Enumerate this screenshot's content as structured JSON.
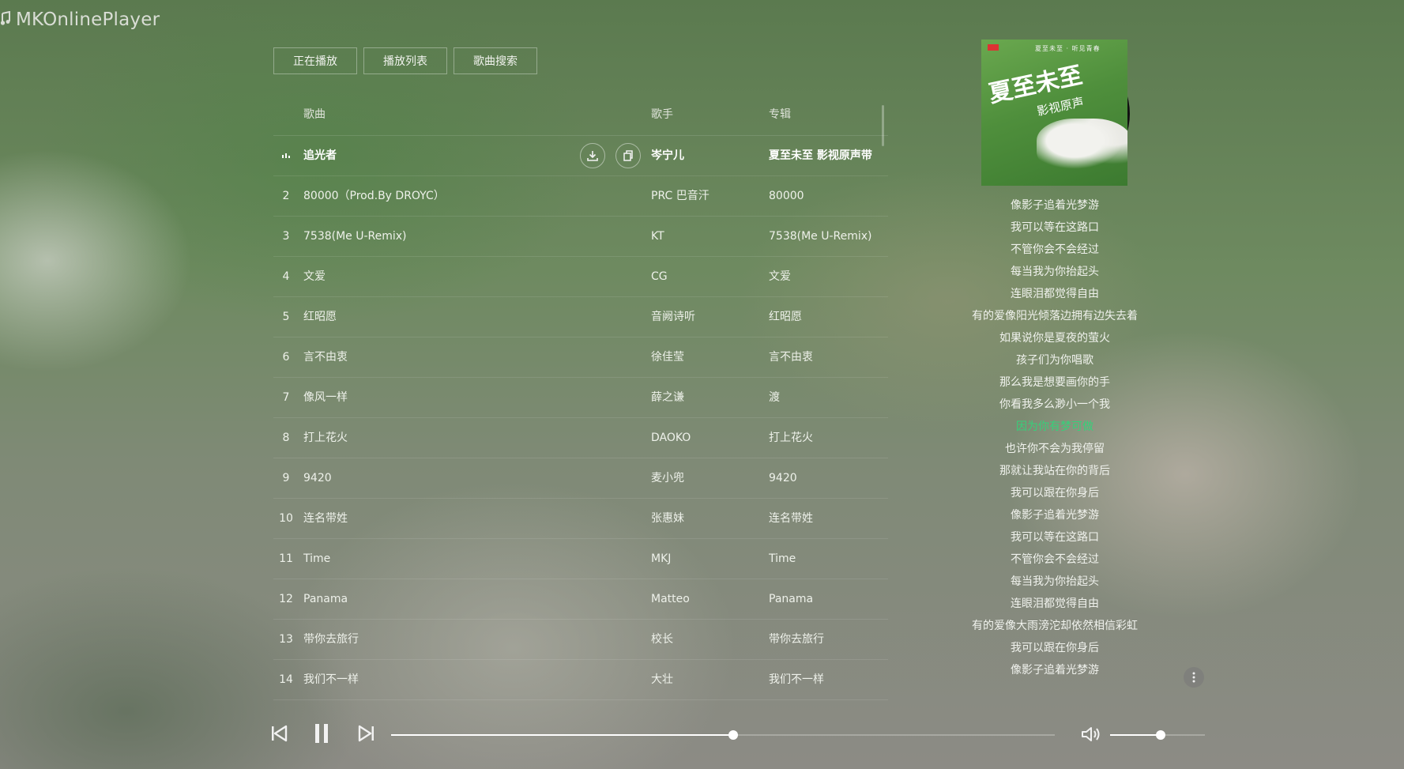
{
  "app": {
    "title": "MKOnlinePlayer",
    "icon": "music-note-icon"
  },
  "tabs": [
    {
      "label": "正在播放"
    },
    {
      "label": "播放列表"
    },
    {
      "label": "歌曲搜索"
    }
  ],
  "list": {
    "headers": {
      "song": "歌曲",
      "artist": "歌手",
      "album": "专辑"
    },
    "rows": [
      {
        "num": "",
        "title": "追光者",
        "artist": "岑宁儿",
        "album": "夏至未至 影视原声带",
        "playing": true
      },
      {
        "num": "2",
        "title": "80000（Prod.By DROYC）",
        "artist": "PRC 巴音汗",
        "album": "80000"
      },
      {
        "num": "3",
        "title": "7538(Me U-Remix)",
        "artist": "KT",
        "album": "7538(Me U-Remix)"
      },
      {
        "num": "4",
        "title": "文爱",
        "artist": "CG",
        "album": "文爱"
      },
      {
        "num": "5",
        "title": "红昭愿",
        "artist": "音阙诗听",
        "album": "红昭愿"
      },
      {
        "num": "6",
        "title": "言不由衷",
        "artist": "徐佳莹",
        "album": "言不由衷"
      },
      {
        "num": "7",
        "title": "像风一样",
        "artist": "薛之谦",
        "album": "渡"
      },
      {
        "num": "8",
        "title": "打上花火",
        "artist": "DAOKO",
        "album": "打上花火"
      },
      {
        "num": "9",
        "title": "9420",
        "artist": "麦小兜",
        "album": "9420"
      },
      {
        "num": "10",
        "title": "连名带姓",
        "artist": "张惠妹",
        "album": "连名带姓"
      },
      {
        "num": "11",
        "title": "Time",
        "artist": "MKJ",
        "album": "Time"
      },
      {
        "num": "12",
        "title": "Panama",
        "artist": "Matteo",
        "album": "Panama"
      },
      {
        "num": "13",
        "title": "带你去旅行",
        "artist": "校长",
        "album": "带你去旅行"
      },
      {
        "num": "14",
        "title": "我们不一样",
        "artist": "大壮",
        "album": "我们不一样"
      }
    ]
  },
  "album_cover": {
    "title": "夏至未至",
    "subtitle": "影视原声",
    "top_text": "夏至未至 · 听见青春"
  },
  "lyrics": {
    "current_index": 10,
    "lines": [
      "像影子追着光梦游",
      "我可以等在这路口",
      "不管你会不会经过",
      "每当我为你抬起头",
      "连眼泪都觉得自由",
      "有的爱像阳光倾落边拥有边失去着",
      "如果说你是夏夜的萤火",
      "孩子们为你唱歌",
      "那么我是想要画你的手",
      "你看我多么渺小一个我",
      "因为你有梦可做",
      "也许你不会为我停留",
      "那就让我站在你的背后",
      "我可以跟在你身后",
      "像影子追着光梦游",
      "我可以等在这路口",
      "不管你会不会经过",
      "每当我为你抬起头",
      "连眼泪都觉得自由",
      "有的爱像大雨滂沱却依然相信彩虹",
      "我可以跟在你身后",
      "像影子追着光梦游"
    ]
  },
  "player": {
    "progress": 0.516,
    "volume": 0.53,
    "accent_color": "#35d17a"
  }
}
